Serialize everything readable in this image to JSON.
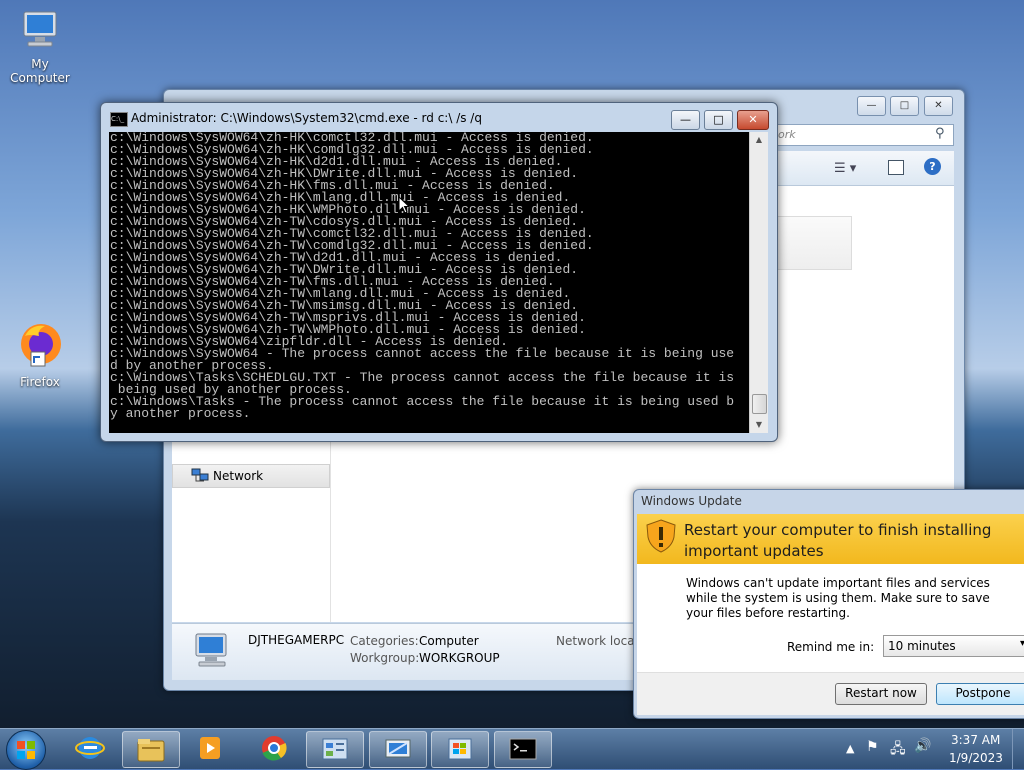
{
  "desktop": {
    "icons": [
      {
        "label": "My Computer",
        "icon": "computer-icon"
      },
      {
        "label": "Firefox",
        "icon": "firefox-icon"
      }
    ]
  },
  "explorer": {
    "search_placeholder": "work",
    "nav_network": "Network",
    "details": {
      "computer_name": "DJTHEGAMERPC",
      "categories_label": "Categories:",
      "categories_value": "Computer",
      "workgroup_label": "Workgroup:",
      "workgroup_value": "WORKGROUP",
      "network_label": "Network locati"
    }
  },
  "cmd": {
    "title": "Administrator: C:\\Windows\\System32\\cmd.exe - rd  c:\\ /s /q",
    "lines": [
      "c:\\Windows\\SysWOW64\\zh-HK\\comctl32.dll.mui - Access is denied.",
      "c:\\Windows\\SysWOW64\\zh-HK\\comdlg32.dll.mui - Access is denied.",
      "c:\\Windows\\SysWOW64\\zh-HK\\d2d1.dll.mui - Access is denied.",
      "c:\\Windows\\SysWOW64\\zh-HK\\DWrite.dll.mui - Access is denied.",
      "c:\\Windows\\SysWOW64\\zh-HK\\fms.dll.mui - Access is denied.",
      "c:\\Windows\\SysWOW64\\zh-HK\\mlang.dll.mui - Access is denied.",
      "c:\\Windows\\SysWOW64\\zh-HK\\WMPhoto.dll.mui - Access is denied.",
      "c:\\Windows\\SysWOW64\\zh-TW\\cdosys.dll.mui - Access is denied.",
      "c:\\Windows\\SysWOW64\\zh-TW\\comctl32.dll.mui - Access is denied.",
      "c:\\Windows\\SysWOW64\\zh-TW\\comdlg32.dll.mui - Access is denied.",
      "c:\\Windows\\SysWOW64\\zh-TW\\d2d1.dll.mui - Access is denied.",
      "c:\\Windows\\SysWOW64\\zh-TW\\DWrite.dll.mui - Access is denied.",
      "c:\\Windows\\SysWOW64\\zh-TW\\fms.dll.mui - Access is denied.",
      "c:\\Windows\\SysWOW64\\zh-TW\\mlang.dll.mui - Access is denied.",
      "c:\\Windows\\SysWOW64\\zh-TW\\msimsg.dll.mui - Access is denied.",
      "c:\\Windows\\SysWOW64\\zh-TW\\msprivs.dll.mui - Access is denied.",
      "c:\\Windows\\SysWOW64\\zh-TW\\WMPhoto.dll.mui - Access is denied.",
      "c:\\Windows\\SysWOW64\\zipfldr.dll - Access is denied.",
      "c:\\Windows\\SysWOW64 - The process cannot access the file because it is being use",
      "d by another process.",
      "c:\\Windows\\Tasks\\SCHEDLGU.TXT - The process cannot access the file because it is",
      " being used by another process.",
      "c:\\Windows\\Tasks - The process cannot access the file because it is being used b",
      "y another process."
    ]
  },
  "update": {
    "window_title": "Windows Update",
    "heading": "Restart your computer to finish installing important updates",
    "message": "Windows can't update important files and services while the system is using them. Make sure to save your files before restarting.",
    "remind_label": "Remind me in:",
    "remind_value": "10 minutes",
    "restart_label": "Restart now",
    "postpone_label": "Postpone"
  },
  "taskbar": {
    "time": "3:37 AM",
    "date": "1/9/2023",
    "apps": [
      "file-explorer-icon",
      "internet-explorer-icon",
      "media-player-icon",
      "chrome-icon",
      "control-panel-icon",
      "network-icon",
      "windows-update-icon",
      "cmd-icon"
    ]
  }
}
